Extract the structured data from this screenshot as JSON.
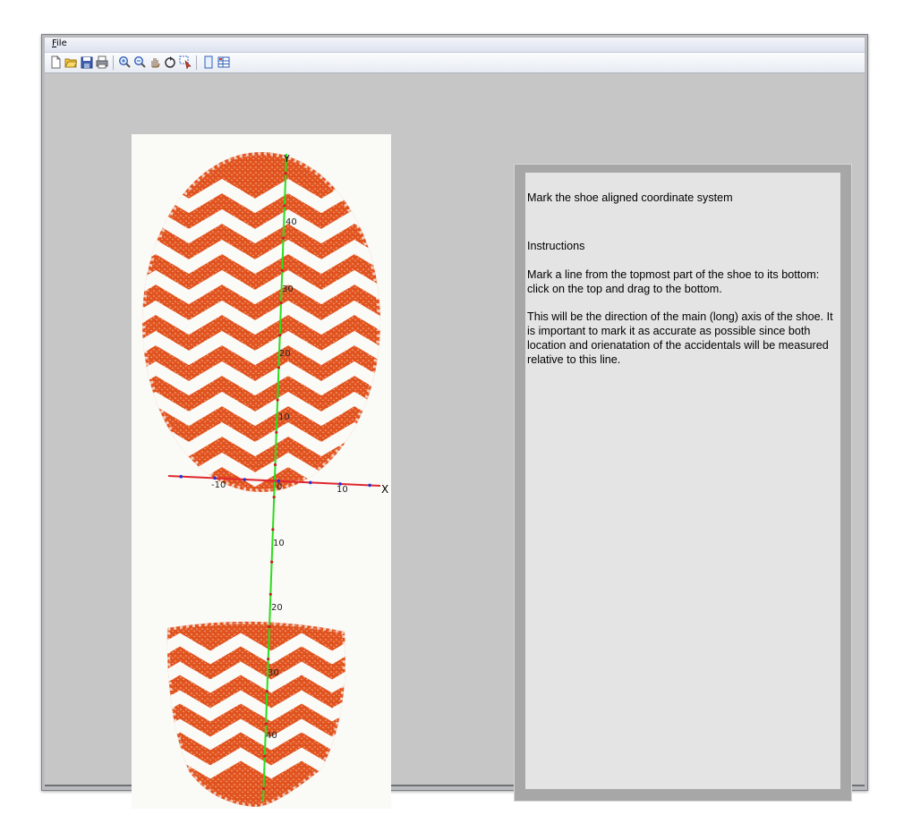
{
  "menu": {
    "file_label": "File"
  },
  "toolbar": {
    "buttons": [
      "new-icon",
      "open-icon",
      "save-icon",
      "print-icon",
      "zoom-in-icon",
      "zoom-out-icon",
      "pan-hand-icon",
      "rotate-icon",
      "select-icon",
      "single-page-icon",
      "split-view-icon"
    ]
  },
  "canvas": {
    "y_axis_label": "Y",
    "x_axis_label": "X",
    "y_ticks_up": [
      "40",
      "30",
      "20",
      "10"
    ],
    "x_ticks": [
      "-10",
      "0",
      "10"
    ],
    "y_ticks_down": [
      "10",
      "20",
      "30",
      "40"
    ],
    "colors": {
      "sole": "#e2541f",
      "y_axis": "#2ddc1c",
      "x_axis": "#e0282e",
      "markers_y": "#c81e1e",
      "markers_x": "#2732d0"
    }
  },
  "info": {
    "heading": "Mark the shoe aligned coordinate system",
    "instructions_title": "Instructions",
    "paragraph1": "Mark a line from the topmost part of the shoe to its bottom: click on the top and drag to the bottom.",
    "paragraph2": "This will be the direction of the main (long) axis of the shoe. It is important to mark it as accurate as possible since both location and orienatation of the accidentals will be measured relative to this line."
  }
}
